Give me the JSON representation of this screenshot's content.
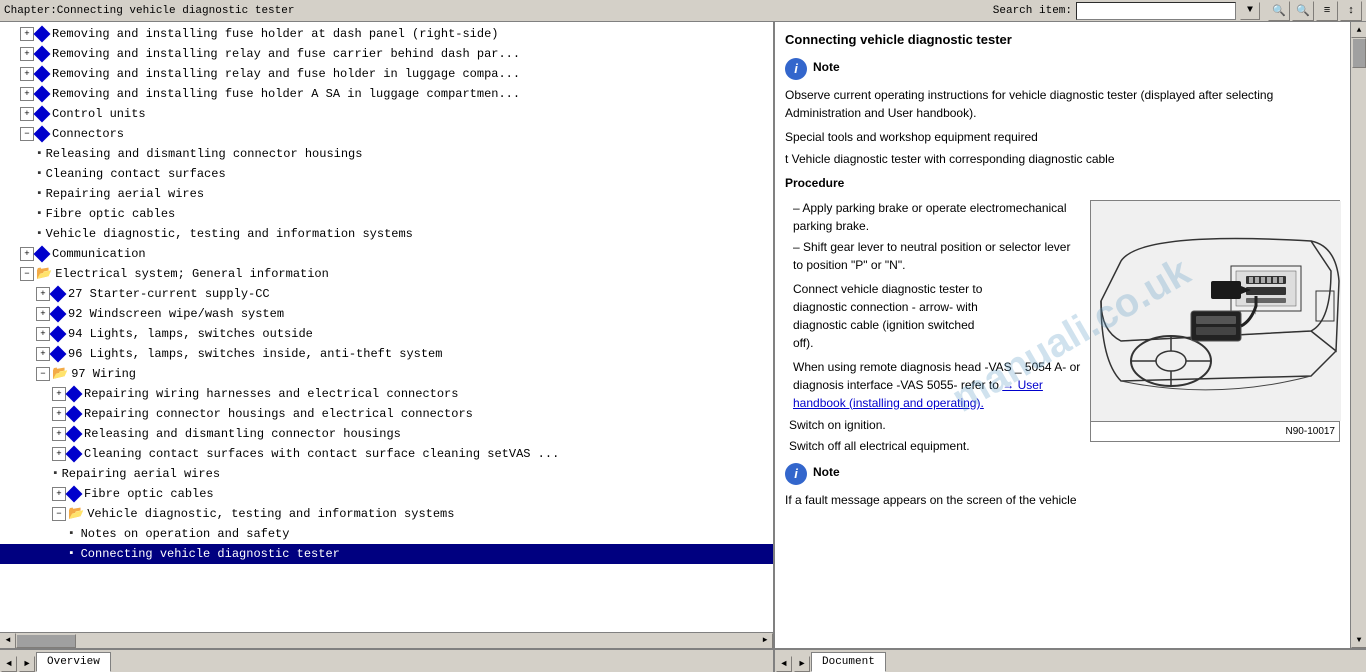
{
  "titleBar": {
    "title": "Chapter:Connecting vehicle diagnostic tester",
    "searchLabel": "Search item:",
    "searchPlaceholder": ""
  },
  "toolbar": {
    "buttons": [
      "🔍",
      "🔍",
      "≡",
      "↕"
    ]
  },
  "leftPanel": {
    "treeItems": [
      {
        "id": "item1",
        "level": 2,
        "type": "doc",
        "text": "Removing and installing fuse holder at dash panel (right-side)",
        "expanded": false
      },
      {
        "id": "item2",
        "level": 2,
        "type": "doc",
        "text": "Removing and installing relay and fuse carrier behind dash par..."
      },
      {
        "id": "item3",
        "level": 2,
        "type": "doc",
        "text": "Removing and installing relay and fuse holder in luggage compa..."
      },
      {
        "id": "item4",
        "level": 2,
        "type": "doc",
        "text": "Removing and installing fuse holder A SA in luggage compartmen..."
      },
      {
        "id": "item5",
        "level": 1,
        "type": "folder",
        "text": "Control units",
        "expanded": false
      },
      {
        "id": "item6",
        "level": 1,
        "type": "folder",
        "text": "Connectors",
        "expanded": true
      },
      {
        "id": "item7",
        "level": 2,
        "type": "doc",
        "text": "Releasing and dismantling connector housings"
      },
      {
        "id": "item8",
        "level": 2,
        "type": "doc",
        "text": "Cleaning contact surfaces"
      },
      {
        "id": "item9",
        "level": 2,
        "type": "doc",
        "text": "Repairing aerial wires"
      },
      {
        "id": "item10",
        "level": 2,
        "type": "doc",
        "text": "Fibre optic cables"
      },
      {
        "id": "item11",
        "level": 2,
        "type": "doc",
        "text": "Vehicle diagnostic, testing and information systems"
      },
      {
        "id": "item12",
        "level": 1,
        "type": "folder",
        "text": "Communication",
        "expanded": false
      },
      {
        "id": "item13",
        "level": 1,
        "type": "folder-open",
        "text": "Electrical system; General information",
        "expanded": true
      },
      {
        "id": "item14",
        "level": 2,
        "type": "folder",
        "text": "27 Starter-current supply-CC",
        "expanded": false
      },
      {
        "id": "item15",
        "level": 2,
        "type": "folder",
        "text": "92 Windscreen wipe/wash system",
        "expanded": false
      },
      {
        "id": "item16",
        "level": 2,
        "type": "folder",
        "text": "94 Lights, lamps, switches outside",
        "expanded": false
      },
      {
        "id": "item17",
        "level": 2,
        "type": "folder",
        "text": "96 Lights, lamps, switches inside, anti-theft system",
        "expanded": false
      },
      {
        "id": "item18",
        "level": 2,
        "type": "folder-open",
        "text": "97 Wiring",
        "expanded": true
      },
      {
        "id": "item19",
        "level": 3,
        "type": "folder",
        "text": "Repairing wiring harnesses and electrical connectors",
        "expanded": false
      },
      {
        "id": "item20",
        "level": 3,
        "type": "folder",
        "text": "Repairing connector housings and electrical connectors",
        "expanded": false
      },
      {
        "id": "item21",
        "level": 3,
        "type": "folder",
        "text": "Releasing and dismantling connector housings",
        "expanded": false
      },
      {
        "id": "item22",
        "level": 3,
        "type": "folder",
        "text": "Cleaning contact surfaces with contact surface cleaning setVAS ...",
        "expanded": false
      },
      {
        "id": "item23",
        "level": 3,
        "type": "doc",
        "text": "Repairing aerial wires"
      },
      {
        "id": "item24",
        "level": 3,
        "type": "folder",
        "text": "Fibre optic cables",
        "expanded": false
      },
      {
        "id": "item25",
        "level": 3,
        "type": "folder-open",
        "text": "Vehicle diagnostic, testing and information systems",
        "expanded": true
      },
      {
        "id": "item26",
        "level": 4,
        "type": "doc",
        "text": "Notes on operation and safety"
      },
      {
        "id": "item27",
        "level": 4,
        "type": "doc",
        "text": "Connecting vehicle diagnostic tester",
        "active": true
      }
    ]
  },
  "rightPanel": {
    "title": "Connecting vehicle diagnostic tester",
    "noteLabel1": "Note",
    "noteText1": "Observe current operating instructions for vehicle diagnostic tester (displayed after selecting Administration and User handbook).",
    "specialToolsLabel": "Special tools and workshop equipment required",
    "toolText": "t  Vehicle diagnostic tester with corresponding diagnostic cable",
    "procedureLabel": "Procedure",
    "steps": [
      "Apply parking brake or operate electromechanical parking brake.",
      "Shift gear lever to neutral position or selector lever to position \"P\" or \"N\"."
    ],
    "connectText1": "Connect vehicle diagnostic tester to",
    "connectText2": "diagnostic connection - arrow- with diagnostic cable (ignition switched off).",
    "arrowText": "arrow - With diagnostic",
    "remoteText1": "When using remote diagnosis head -VAS _ 5054 A- or diagnosis interface -VAS 5055- refer to",
    "linkText": "→ User handbook (installing and operating).",
    "step3": "Switch on ignition.",
    "step4": "Switch off all electrical equipment.",
    "noteLabel2": "Note",
    "noteText2": "If a fault message appears on the screen of the vehicle",
    "diagramLabel": "N90-10017"
  },
  "bottomTabs": {
    "leftTabs": [
      {
        "label": "Overview",
        "active": true
      }
    ],
    "rightTabs": [
      {
        "label": "Document",
        "active": true
      }
    ]
  }
}
